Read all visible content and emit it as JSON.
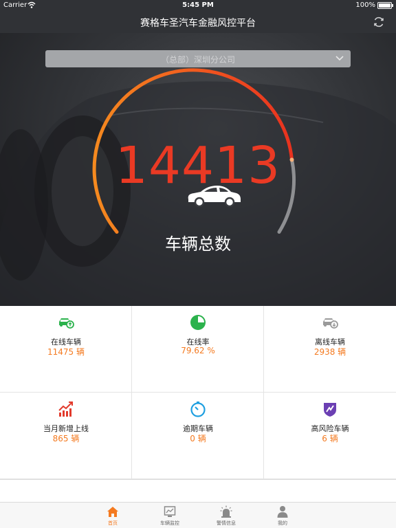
{
  "status_bar": {
    "carrier": "Carrier",
    "time": "5:45 PM",
    "battery": "100%",
    "battery_level": 1.0
  },
  "nav": {
    "title": "赛格车圣汽车金融风控平台"
  },
  "branch_selector": {
    "value": "（总部）深圳分公司"
  },
  "summary": {
    "total": "14413",
    "total_label": "车辆总数"
  },
  "stats": [
    {
      "label": "在线车辆",
      "value": "11475 辆",
      "icon": "online-car-icon",
      "color": "#2bb24c"
    },
    {
      "label": "在线率",
      "value": "79.62 %",
      "icon": "pie-chart-icon",
      "color": "#2bb24c"
    },
    {
      "label": "离线车辆",
      "value": "2938 辆",
      "icon": "offline-car-icon",
      "color": "#9a9a9a"
    },
    {
      "label": "当月新增上线",
      "value": "865 辆",
      "icon": "trend-up-icon",
      "color": "#e23a2c"
    },
    {
      "label": "逾期车辆",
      "value": "0 辆",
      "icon": "timer-icon",
      "color": "#1e9fe0"
    },
    {
      "label": "高风险车辆",
      "value": "6 辆",
      "icon": "shield-icon",
      "color": "#6b3fb3"
    }
  ],
  "tabs": [
    {
      "label": "首页",
      "icon": "home-icon",
      "active": true
    },
    {
      "label": "车辆监控",
      "icon": "monitor-icon",
      "active": false
    },
    {
      "label": "警情信息",
      "icon": "alarm-icon",
      "active": false
    },
    {
      "label": "我的",
      "icon": "user-icon",
      "active": false
    }
  ],
  "colors": {
    "accent": "#f47a20",
    "header_bg": "#303236",
    "number_red": "#ea3a24"
  }
}
